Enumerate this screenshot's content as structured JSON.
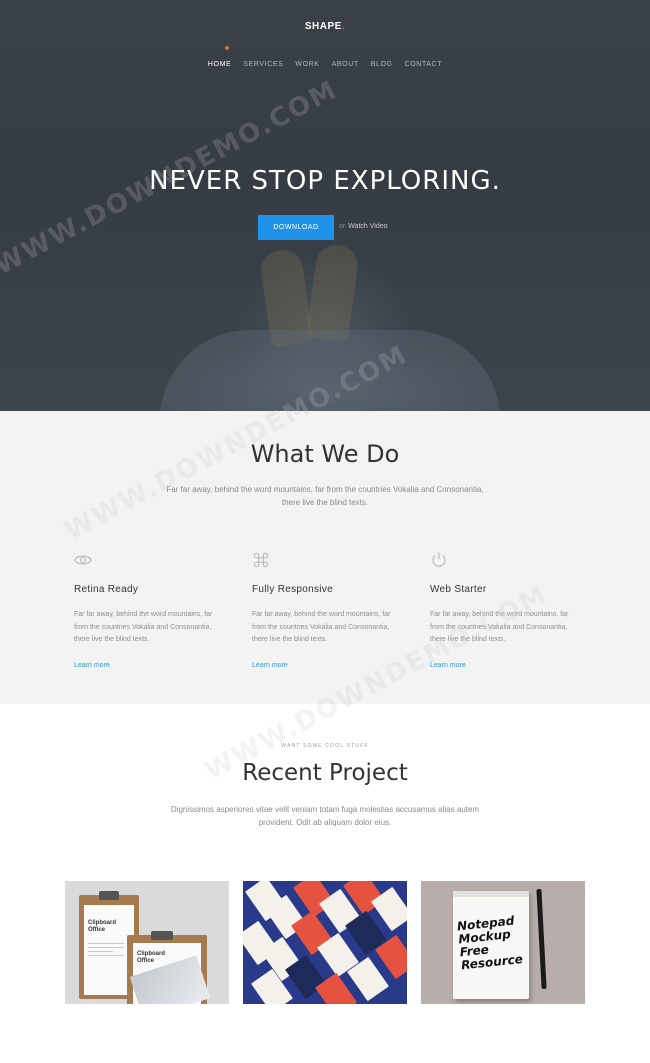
{
  "header": {
    "logo": "SHAPE",
    "logo_dot": ".",
    "nav": [
      "HOME",
      "SERVICES",
      "WORK",
      "ABOUT",
      "BLOG",
      "CONTACT"
    ]
  },
  "hero": {
    "title": "NEVER STOP EXPLORING.",
    "download_label": "DOWNLOAD",
    "or_text": "or",
    "watch_label": "Watch Video"
  },
  "what_we_do": {
    "title": "What We Do",
    "subtitle": "Far far away, behind the word mountains, far from the countries Vokalia and Consonantia, there live the blind texts.",
    "features": [
      {
        "icon": "eye-icon",
        "title": "Retina Ready",
        "text": "Far far away, behind the word mountains, far from the countries Vokalia and Consonantia, there live the blind texts.",
        "link": "Learn more"
      },
      {
        "icon": "command-icon",
        "title": "Fully Responsive",
        "text": "Far far away, behind the word mountains, far from the countries Vokalia and Consonantia, there live the blind texts.",
        "link": "Learn more"
      },
      {
        "icon": "power-icon",
        "title": "Web Starter",
        "text": "Far far away, behind the word mountains, far from the countries Vokalia and Consonantia, there live the blind texts.",
        "link": "Learn more"
      }
    ]
  },
  "recent_project": {
    "kicker": "WANT SOME COOL STUFF",
    "title": "Recent Project",
    "subtitle": "Dignissimos asperiores vitae velit veniam totam fuga molestias accusamus alias autem provident. Odit ab aliquam dolor eius.",
    "thumbs": [
      {
        "label": "Clipboard Office",
        "lines": [
          "Clipboard",
          "Office"
        ]
      },
      {
        "label": "cards"
      },
      {
        "label": "Notepad Mockup Free Resource",
        "lines": [
          "Notepad",
          "Mockup",
          "Free",
          "Resource"
        ]
      }
    ]
  },
  "watermark": "WWW.DOWNDEMO.COM",
  "colors": {
    "accent": "#1e93e8",
    "logo_dot": "#e8673c",
    "link": "#2b9ae2",
    "section_bg": "#f3f3f3"
  }
}
